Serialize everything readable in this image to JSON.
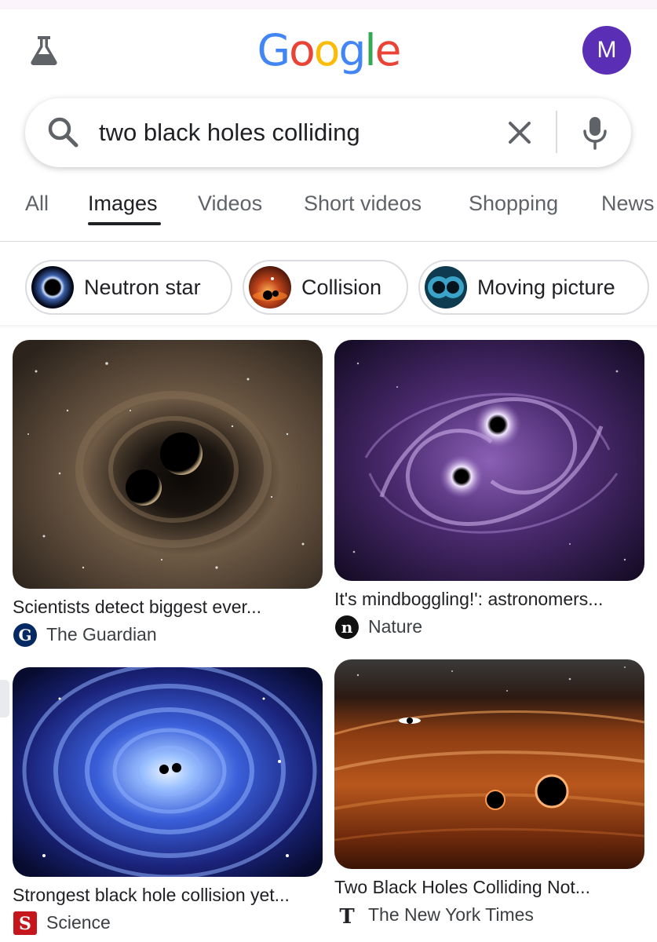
{
  "header": {
    "logo_letters": [
      {
        "char": "G",
        "color": "#4285F4"
      },
      {
        "char": "o",
        "color": "#EA4335"
      },
      {
        "char": "o",
        "color": "#FBBC05"
      },
      {
        "char": "g",
        "color": "#4285F4"
      },
      {
        "char": "l",
        "color": "#34A853"
      },
      {
        "char": "e",
        "color": "#EA4335"
      }
    ],
    "labs_icon": "flask-icon",
    "avatar_initial": "M",
    "avatar_color": "#5b2fb5"
  },
  "search": {
    "query": "two black holes colliding",
    "icons": [
      "search-icon",
      "clear-icon",
      "mic-icon"
    ]
  },
  "tabs": [
    {
      "label": "All",
      "active": false
    },
    {
      "label": "Images",
      "active": true
    },
    {
      "label": "Videos",
      "active": false
    },
    {
      "label": "Short videos",
      "active": false
    },
    {
      "label": "Shopping",
      "active": false
    },
    {
      "label": "News",
      "active": false
    }
  ],
  "chips": [
    {
      "label": "Neutron star",
      "thumb": "neutron-star-thumb"
    },
    {
      "label": "Collision",
      "thumb": "collision-thumb"
    },
    {
      "label": "Moving picture",
      "thumb": "moving-picture-thumb"
    }
  ],
  "results": [
    {
      "title": "Scientists detect biggest ever...",
      "source": "The Guardian",
      "source_icon": "guardian-icon"
    },
    {
      "title": "It's mindboggling!': astronomers...",
      "source": "Nature",
      "source_icon": "nature-icon"
    },
    {
      "title": "Strongest black hole collision yet...",
      "source": "Science",
      "source_icon": "science-icon"
    },
    {
      "title": "Two Black Holes Colliding Not...",
      "source": "The New York Times",
      "source_icon": "nyt-icon"
    }
  ]
}
